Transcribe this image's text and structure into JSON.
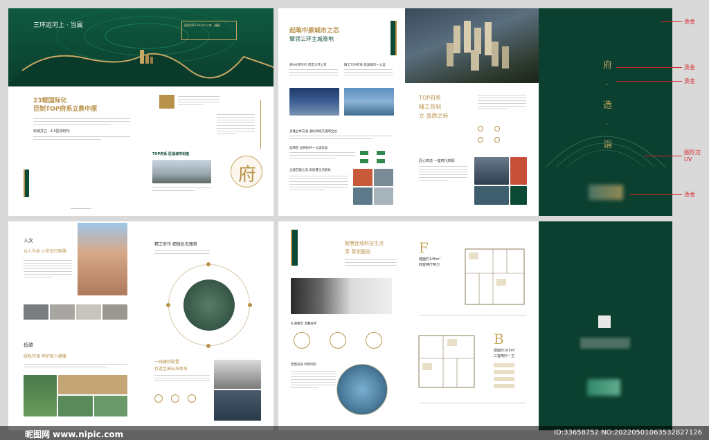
{
  "annotations": [
    "烫金",
    "烫金",
    "烫金",
    "图形过UV",
    "烫金"
  ],
  "p1": {
    "headline": "三环运河上 · 当属",
    "gold_box_text": "建面约85-145m²三房 · 臻藏"
  },
  "p2_left": {
    "title_l1": "23载国际化",
    "title_l2": "巨制TOP府系立鼎中原",
    "sub": "双城并立 · 4.0匠领时代"
  },
  "p2_right": {
    "label": "TOP府系   匠造城市封面",
    "seal": "府"
  },
  "p3": {
    "title_l1": "起笔中原城市之芯",
    "title_l2": "擘领三环主城贵地",
    "sec1": "郑州4环时代  府定三环之贵",
    "sec2": "精工TOP府系  醇美臻享一公里",
    "sec3": "多维立体交通  通达郑城交通网全位",
    "sec4": "品牌匠  品牌标杆一公里标准",
    "sec5": "全能芯能之选  高质量生活新标"
  },
  "p4": {
    "title_l1": "TOP府系",
    "title_l2": "精工巨制",
    "title_l3": "立   品质之新",
    "sec": "匠心筑造  一座时代府邸"
  },
  "cover": {
    "vertical": "府 · 造 · 诣"
  },
  "p5": {
    "tag1": "人文",
    "title1": "以人为本  心安处归家路",
    "tag2": "低碳",
    "title2": "绿色环保  呵护家人健康"
  },
  "p6": {
    "title": "精工府作  细微处见臻筑",
    "title2_l1": "一线建材配置",
    "title2_l2": "打造至高标准体系"
  },
  "p7": {
    "title_l1": "智慧连线科技生活",
    "title_l2": "享         尊崇服务",
    "sec1": "礼遇尊享  温馨关怀",
    "sec2": "智慧安防  时刻呵护"
  },
  "p8": {
    "type_f": "F",
    "area_f": "建面约146m²",
    "layout_f": "四室两厅两卫",
    "type_b": "B",
    "area_b": "建面约105m²",
    "layout_b": "三室两厅一卫"
  },
  "watermark": {
    "site": "昵图网 www.nipic.com",
    "id": "ID:33658752 NO:20220501063532827126"
  }
}
